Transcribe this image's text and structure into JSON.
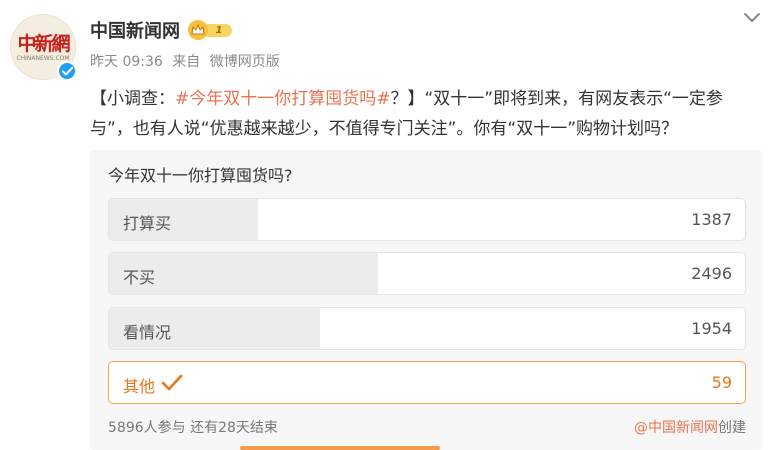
{
  "post": {
    "author": "中国新闻网",
    "badge_level": "1",
    "logo_text": "中新網",
    "logo_subtext": "CHINANEWS.COM",
    "time": "昨天 09:36",
    "source_prefix": "来自",
    "source": "微博网页版",
    "text_open": "【小调查：",
    "hashtag": "#今年双十一你打算囤货吗#",
    "text_rest": "？】“双十一”即将到来，有网友表示“一定参与”，也有人说“优惠越来越少，不值得专门关注”。你有“双十一”购物计划吗？"
  },
  "poll": {
    "title": "今年双十一你打算囤货吗?",
    "options": [
      {
        "label": "打算买",
        "count": "1387",
        "share": 0.235,
        "selected": false
      },
      {
        "label": "不买",
        "count": "2496",
        "share": 0.423,
        "selected": false
      },
      {
        "label": "看情况",
        "count": "1954",
        "share": 0.331,
        "selected": false
      },
      {
        "label": "其他",
        "count": "59",
        "share": 0.01,
        "selected": true
      }
    ],
    "participants": "5896人参与",
    "time_left": "还有28天结束",
    "creator_at": "@中国新闻网",
    "creator_suffix": "创建"
  },
  "icons": {
    "more": "chevron-down-icon",
    "verified": "verified-check-icon",
    "crown": "crown-icon",
    "selected": "checkmark-icon"
  },
  "colors": {
    "accent": "#eb7350",
    "selected_border": "#f5a34a",
    "verified_blue": "#1da0f2"
  }
}
